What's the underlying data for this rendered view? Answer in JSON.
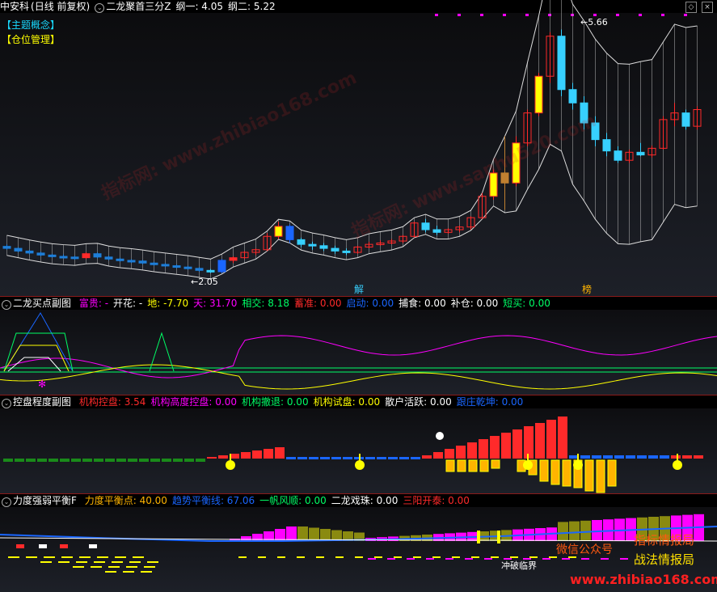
{
  "colors": {
    "up": "#ff2a2a",
    "down": "#37d0ff",
    "yellow": "#ffff00",
    "magenta": "#ff00ff",
    "green": "#00ff66",
    "orange": "#ffb400",
    "white": "#ffffff",
    "blue": "#1a66ff",
    "olive": "#8a8a10"
  },
  "main": {
    "title": "中安科",
    "period": "(日线 前复权)",
    "indicator": "二龙聚首三分Z",
    "line1": "纲一: 4.05",
    "line2": "纲二: 5.22",
    "badge1": "【主题概念】",
    "badge2": "【仓位管理】",
    "low_label": "←2.05",
    "high_label": "←5.66",
    "mark_jie": "解",
    "mark_bang": "榜"
  },
  "sub1": {
    "title": "二龙买点副图",
    "items": [
      {
        "t": "富贵: -",
        "c": "#ff00ff"
      },
      {
        "t": "开花: -",
        "c": "#ffffff"
      },
      {
        "t": "地: -7.70",
        "c": "#ffff00"
      },
      {
        "t": "天: 31.70",
        "c": "#ff00ff"
      },
      {
        "t": "相交: 8.18",
        "c": "#00ff66"
      },
      {
        "t": "蓄准: 0.00",
        "c": "#ff2a2a"
      },
      {
        "t": "启动: 0.00",
        "c": "#1a66ff"
      },
      {
        "t": "捕食: 0.00",
        "c": "#ffffff"
      },
      {
        "t": "补仓: 0.00",
        "c": "#ffffff"
      },
      {
        "t": "短买: 0.00",
        "c": "#00ff66"
      }
    ]
  },
  "sub2": {
    "title": "控盘程度副图",
    "items": [
      {
        "t": "机构控盘: 3.54",
        "c": "#ff2a2a"
      },
      {
        "t": "机构高度控盘: 0.00",
        "c": "#ff00ff"
      },
      {
        "t": "机构撤退: 0.00",
        "c": "#00ff66"
      },
      {
        "t": "机构试盘: 0.00",
        "c": "#ffff00"
      },
      {
        "t": "散户活跃: 0.00",
        "c": "#ffffff"
      },
      {
        "t": "跟庄乾坤: 0.00",
        "c": "#1a66ff"
      }
    ]
  },
  "sub3": {
    "title": "力度强弱平衡F",
    "items": [
      {
        "t": "力度平衡点: 40.00",
        "c": "#ffb400"
      },
      {
        "t": "趋势平衡线: 67.06",
        "c": "#1a66ff"
      },
      {
        "t": "一帆风顺: 0.00",
        "c": "#00ff66"
      },
      {
        "t": "二龙戏珠: 0.00",
        "c": "#ffffff"
      },
      {
        "t": "三阳开泰: 0.00",
        "c": "#ff2a2a"
      }
    ],
    "notes": [
      "指标情报局",
      "战法情报局",
      "微信公众号",
      "冲破临界",
      "www.zhibiao168.com"
    ]
  },
  "chart_data": [
    {
      "type": "candlestick",
      "title": "中安科 (日线 前复权)",
      "annotations": [
        "←2.05",
        "←5.66",
        "解",
        "榜"
      ],
      "ohlc": [
        [
          2.45,
          2.48,
          2.4,
          2.42
        ],
        [
          2.42,
          2.44,
          2.36,
          2.38
        ],
        [
          2.38,
          2.4,
          2.33,
          2.35
        ],
        [
          2.35,
          2.37,
          2.3,
          2.32
        ],
        [
          2.32,
          2.34,
          2.28,
          2.3
        ],
        [
          2.3,
          2.33,
          2.27,
          2.29
        ],
        [
          2.29,
          2.31,
          2.25,
          2.28
        ],
        [
          2.28,
          2.36,
          2.26,
          2.34
        ],
        [
          2.34,
          2.36,
          2.27,
          2.29
        ],
        [
          2.29,
          2.31,
          2.24,
          2.26
        ],
        [
          2.26,
          2.28,
          2.22,
          2.24
        ],
        [
          2.24,
          2.26,
          2.2,
          2.23
        ],
        [
          2.23,
          2.25,
          2.18,
          2.2
        ],
        [
          2.2,
          2.22,
          2.16,
          2.18
        ],
        [
          2.18,
          2.2,
          2.14,
          2.16
        ],
        [
          2.16,
          2.18,
          2.12,
          2.14
        ],
        [
          2.14,
          2.16,
          2.1,
          2.12
        ],
        [
          2.12,
          2.14,
          2.07,
          2.09
        ],
        [
          2.09,
          2.11,
          2.05,
          2.07
        ],
        [
          2.07,
          2.26,
          2.05,
          2.24
        ],
        [
          2.24,
          2.3,
          2.2,
          2.28
        ],
        [
          2.28,
          2.38,
          2.26,
          2.36
        ],
        [
          2.36,
          2.42,
          2.32,
          2.4
        ],
        [
          2.4,
          2.65,
          2.38,
          2.6
        ],
        [
          2.6,
          2.82,
          2.56,
          2.75
        ],
        [
          2.75,
          2.78,
          2.5,
          2.55
        ],
        [
          2.55,
          2.58,
          2.44,
          2.48
        ],
        [
          2.48,
          2.52,
          2.4,
          2.46
        ],
        [
          2.46,
          2.5,
          2.38,
          2.42
        ],
        [
          2.42,
          2.46,
          2.34,
          2.38
        ],
        [
          2.38,
          2.42,
          2.32,
          2.36
        ],
        [
          2.36,
          2.46,
          2.34,
          2.44
        ],
        [
          2.44,
          2.52,
          2.42,
          2.48
        ],
        [
          2.48,
          2.54,
          2.46,
          2.5
        ],
        [
          2.5,
          2.56,
          2.48,
          2.53
        ],
        [
          2.53,
          2.62,
          2.5,
          2.6
        ],
        [
          2.6,
          2.82,
          2.58,
          2.8
        ],
        [
          2.8,
          2.86,
          2.66,
          2.7
        ],
        [
          2.7,
          2.76,
          2.62,
          2.66
        ],
        [
          2.66,
          2.72,
          2.64,
          2.7
        ],
        [
          2.7,
          2.76,
          2.66,
          2.74
        ],
        [
          2.74,
          2.9,
          2.7,
          2.88
        ],
        [
          2.88,
          3.25,
          2.86,
          3.2
        ],
        [
          3.2,
          3.6,
          3.15,
          3.55
        ],
        [
          3.55,
          4.1,
          3.0,
          3.4
        ],
        [
          3.4,
          4.1,
          3.35,
          4.0
        ],
        [
          4.0,
          4.5,
          3.95,
          4.45
        ],
        [
          4.45,
          5.05,
          4.4,
          5.0
        ],
        [
          5.0,
          5.66,
          4.9,
          5.6
        ],
        [
          5.6,
          5.7,
          4.7,
          4.8
        ],
        [
          4.8,
          4.9,
          4.5,
          4.6
        ],
        [
          4.6,
          4.7,
          4.2,
          4.3
        ],
        [
          4.3,
          4.4,
          3.95,
          4.05
        ],
        [
          4.05,
          4.15,
          3.8,
          3.88
        ],
        [
          3.88,
          3.95,
          3.7,
          3.74
        ],
        [
          3.74,
          3.9,
          3.7,
          3.86
        ],
        [
          3.86,
          4.0,
          3.8,
          3.82
        ],
        [
          3.82,
          3.96,
          3.78,
          3.92
        ],
        [
          3.92,
          4.4,
          3.9,
          4.35
        ],
        [
          4.35,
          4.6,
          4.25,
          4.45
        ],
        [
          4.45,
          4.5,
          4.2,
          4.25
        ],
        [
          4.25,
          4.55,
          4.2,
          4.5
        ]
      ]
    },
    {
      "type": "line",
      "title": "二龙买点副图",
      "series": [
        {
          "name": "天",
          "last": 31.7
        },
        {
          "name": "地",
          "last": -7.7
        },
        {
          "name": "相交",
          "last": 8.18
        }
      ]
    },
    {
      "type": "bar",
      "title": "控盘程度副图",
      "series": [
        {
          "name": "机构控盘",
          "last": 3.54
        }
      ]
    },
    {
      "type": "area",
      "title": "力度强弱平衡F",
      "series": [
        {
          "name": "力度平衡点",
          "last": 40.0
        },
        {
          "name": "趋势平衡线",
          "last": 67.06
        }
      ]
    }
  ]
}
